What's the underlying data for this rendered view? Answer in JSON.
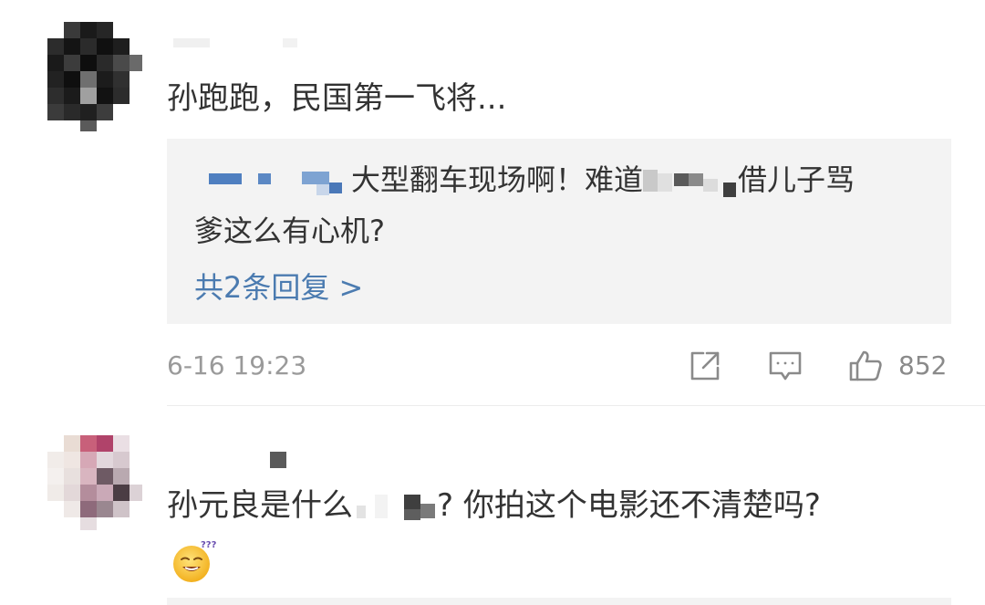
{
  "comments": [
    {
      "text": "孙跑跑，民国第一飞将...",
      "reply": {
        "text_part1": "大型翻车现场啊！难道",
        "text_part2": "借儿子骂",
        "text_line2": "爹这么有心机?",
        "more_label": "共2条回复 >"
      },
      "timestamp": "6-16 19:23",
      "like_count": "852",
      "icons": [
        "share-icon",
        "comment-icon",
        "like-icon"
      ]
    },
    {
      "text_part1": "孙元良是什么",
      "text_part2": "? 你拍这个电影还不清楚吗?",
      "emoji": "confused-smile-emoji"
    }
  ],
  "colors": {
    "link": "#4b7bb0",
    "reply_bg": "#f3f3f3",
    "meta_text": "#9a9a9a",
    "body_text": "#333333"
  }
}
